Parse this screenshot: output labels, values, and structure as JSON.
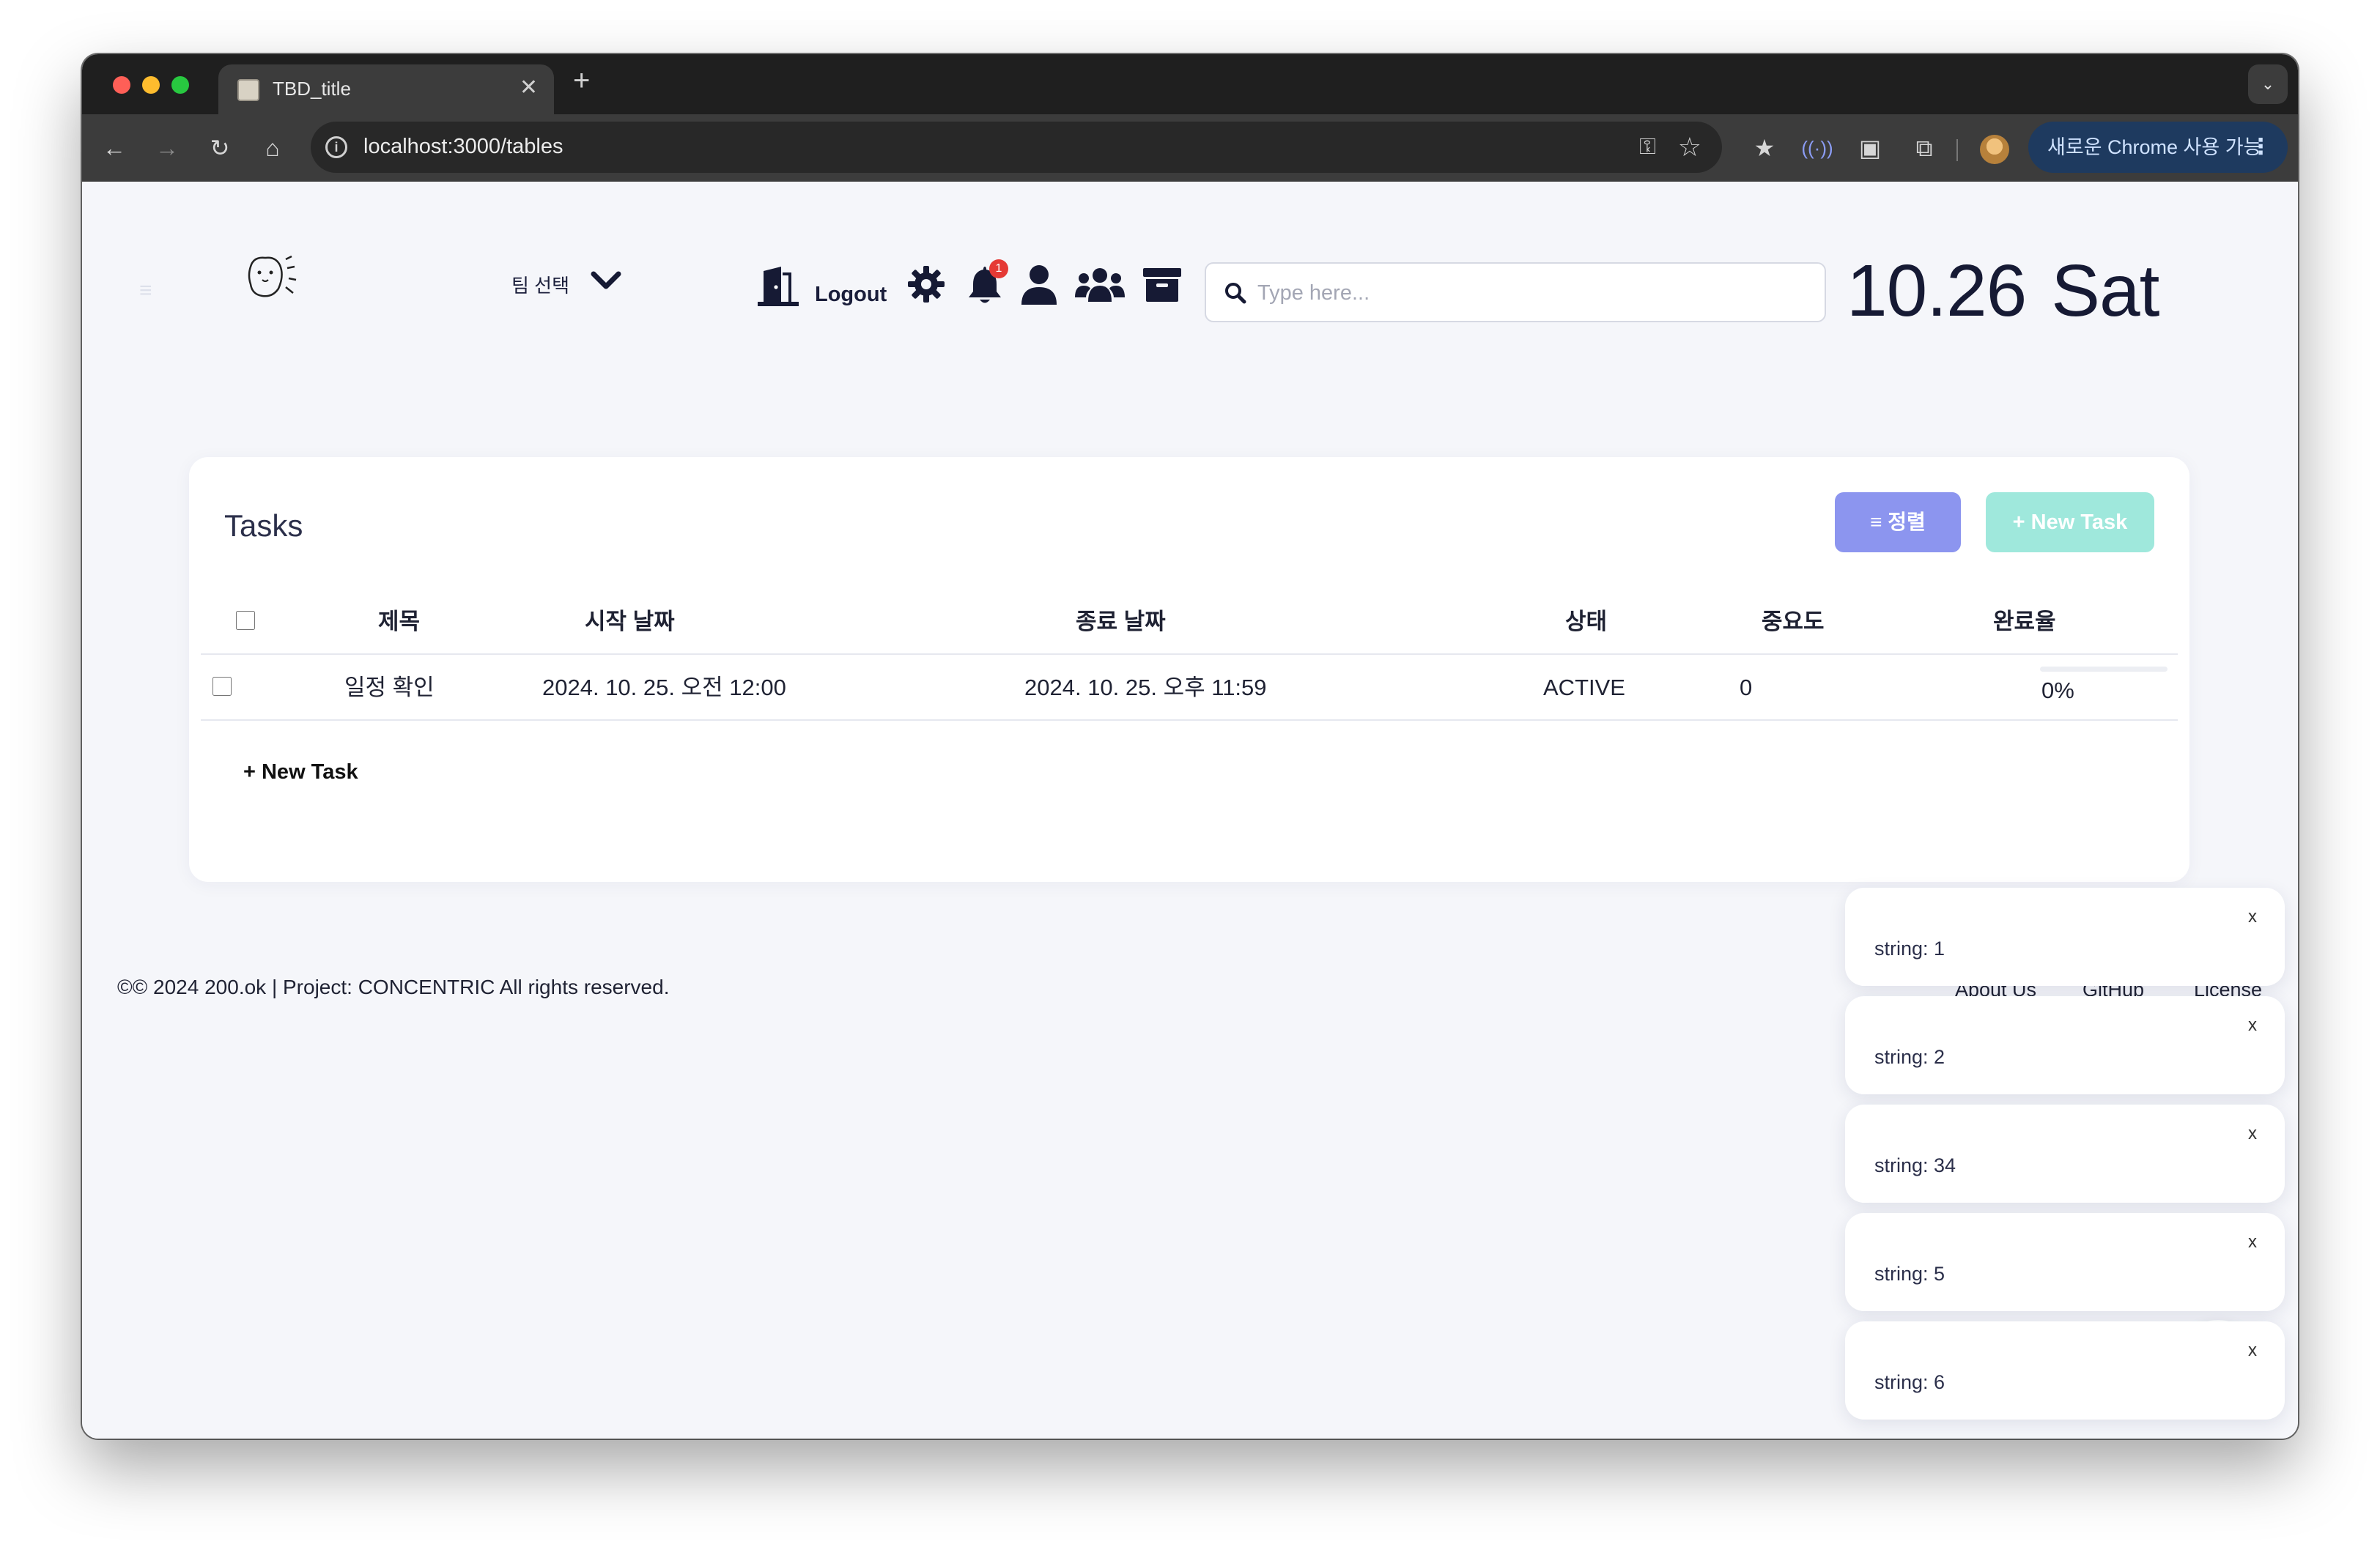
{
  "browser": {
    "tab_title": "TBD_title",
    "tab_close": "✕",
    "new_tab": "+",
    "url": "localhost:3000/tables",
    "update_button": "새로운 Chrome 사용 가능"
  },
  "header": {
    "team_select_label": "팀 선택",
    "logout_label": "Logout",
    "notification_count": "1",
    "search_placeholder": "Type here...",
    "date": "10.26",
    "weekday": "Sat"
  },
  "tasks": {
    "title": "Tasks",
    "sort_button": "≡ 정렬",
    "new_task_button": "+ New Task",
    "columns": [
      "제목",
      "시작 날짜",
      "종료 날짜",
      "상태",
      "중요도",
      "완료율"
    ],
    "rows": [
      {
        "title": "일정 확인",
        "start": "2024. 10. 25. 오전 12:00",
        "end": "2024. 10. 25. 오후 11:59",
        "status": "ACTIVE",
        "priority": "0",
        "progress_label": "0%",
        "progress": 0
      }
    ],
    "add_task_link": "+ New Task"
  },
  "footer": {
    "copyright": "©© 2024 200.ok | Project: CONCENTRIC All rights reserved.",
    "links": [
      "About Us",
      "GitHub",
      "License"
    ]
  },
  "toasts": [
    {
      "text": "string: 1",
      "close": "x"
    },
    {
      "text": "string: 2",
      "close": "x"
    },
    {
      "text": "string: 34",
      "close": "x"
    },
    {
      "text": "string: 5",
      "close": "x"
    },
    {
      "text": "string: 6",
      "close": "x"
    }
  ],
  "colors": {
    "sort_button": "#8c95ef",
    "new_task_button": "#9fe8dc",
    "page_background": "#f5f6fa",
    "header_text": "#161a34",
    "badge": "#e53935"
  }
}
